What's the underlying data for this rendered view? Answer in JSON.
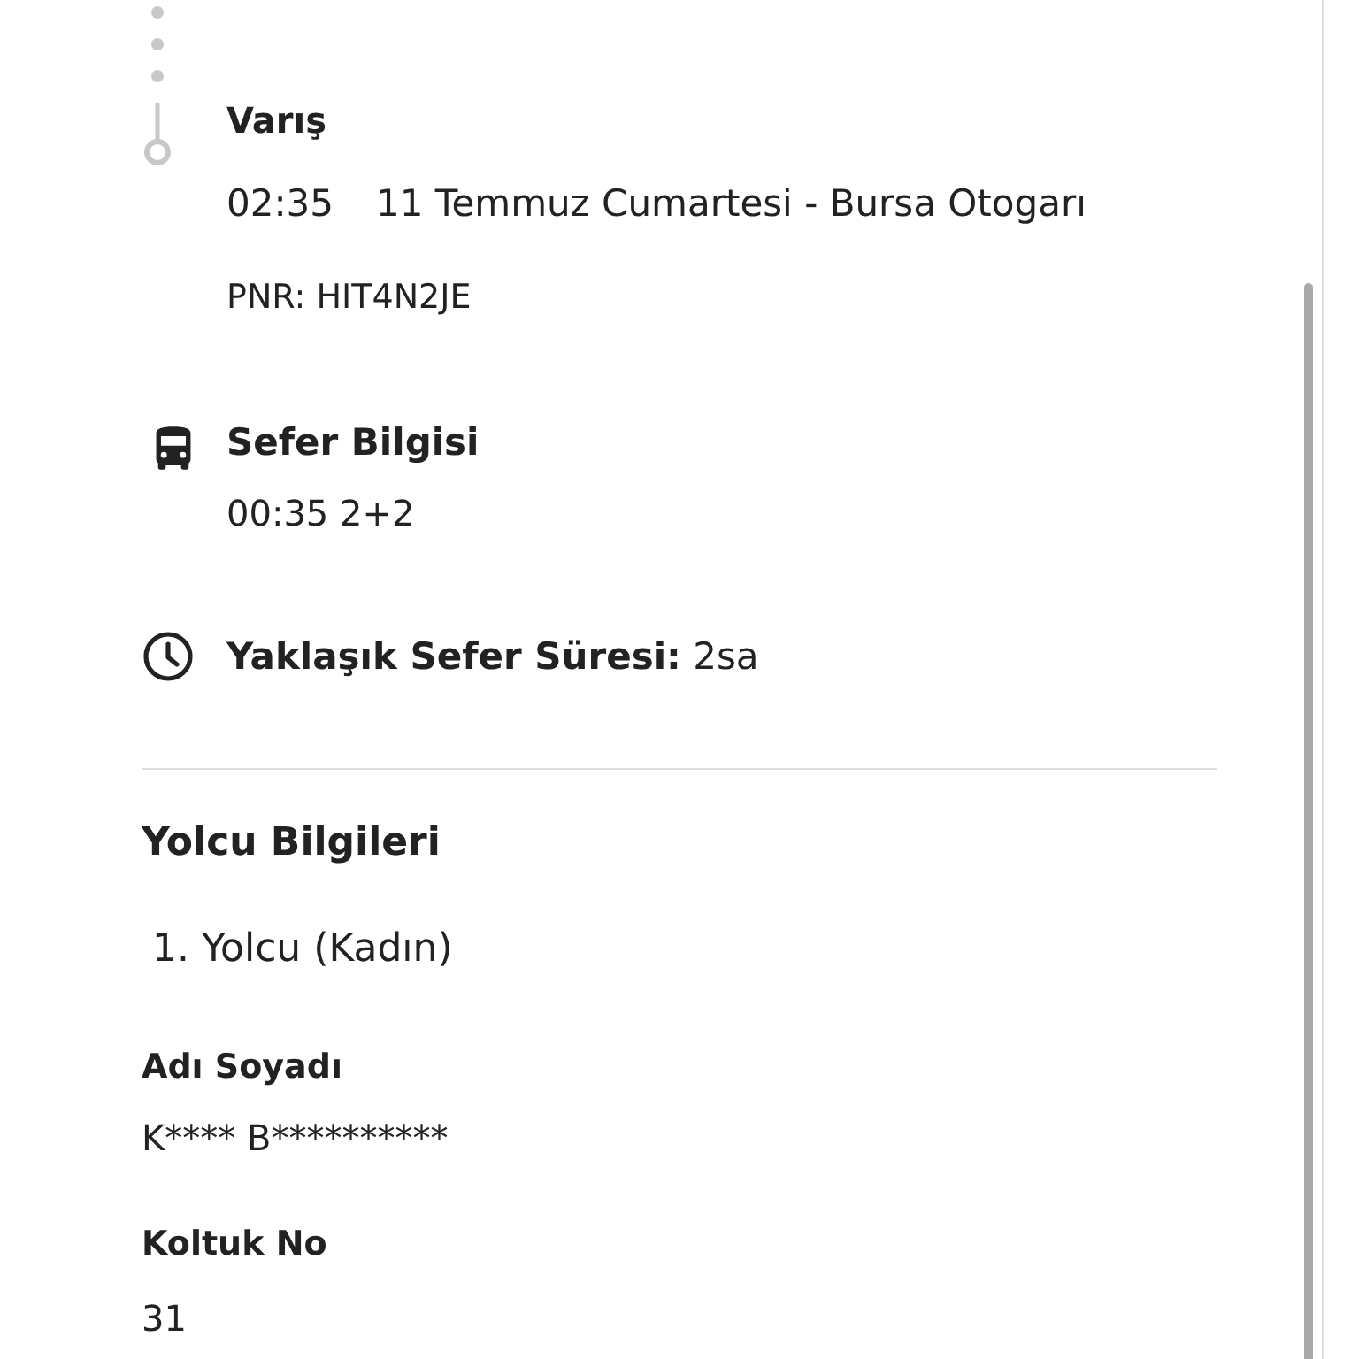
{
  "arrival": {
    "title": "Varış",
    "time": "02:35",
    "detail": "11 Temmuz Cumartesi - Bursa Otogarı",
    "pnr": "PNR: HIT4N2JE"
  },
  "trip_info": {
    "title": "Sefer Bilgisi",
    "value": "00:35 2+2"
  },
  "duration": {
    "text": "**Yaklaşık Sefer Süresi:** 2sa"
  },
  "passengers": {
    "title": "Yolcu Bilgileri",
    "items": [
      {
        "heading": "1. Yolcu (Kadın)",
        "fields": [
          {
            "label": "Adı Soyadı",
            "value": "K**** B**********"
          },
          {
            "label": "Koltuk No",
            "value": "31"
          }
        ]
      }
    ]
  }
}
